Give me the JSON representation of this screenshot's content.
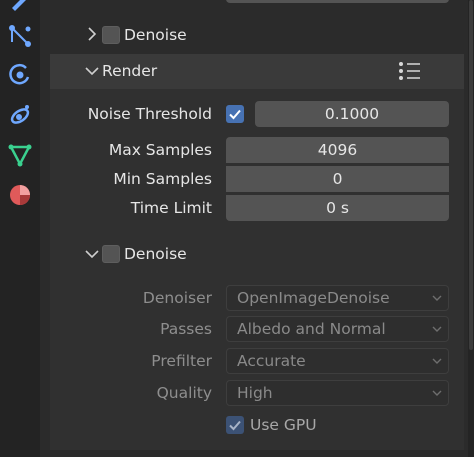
{
  "colors": {
    "accent": "#4772b3",
    "field_bg": "#545454",
    "panel_bg": "#2b2b2b",
    "icon_blue": "#4a9eff",
    "icon_green": "#3ad18f",
    "icon_red": "#e05a5a"
  },
  "sidebar": {
    "icons": [
      "tool-icon",
      "particles-icon",
      "physics-icon",
      "constraints-icon",
      "object-data-icon",
      "material-icon"
    ]
  },
  "sampling": {
    "denoise_header": {
      "label": "Denoise",
      "checked": false,
      "expanded": false
    }
  },
  "render": {
    "header_label": "Render",
    "expanded": true,
    "noise_threshold": {
      "label": "Noise Threshold",
      "enabled": true,
      "value": "0.1000"
    },
    "max_samples": {
      "label": "Max Samples",
      "value": "4096"
    },
    "min_samples": {
      "label": "Min Samples",
      "value": "0"
    },
    "time_limit": {
      "label": "Time Limit",
      "value": "0 s"
    }
  },
  "denoise": {
    "header_label": "Denoise",
    "checked": false,
    "expanded": true,
    "denoiser": {
      "label": "Denoiser",
      "value": "OpenImageDenoise"
    },
    "passes": {
      "label": "Passes",
      "value": "Albedo and Normal"
    },
    "prefilter": {
      "label": "Prefilter",
      "value": "Accurate"
    },
    "quality": {
      "label": "Quality",
      "value": "High"
    },
    "use_gpu": {
      "label": "Use GPU",
      "checked": true
    }
  }
}
